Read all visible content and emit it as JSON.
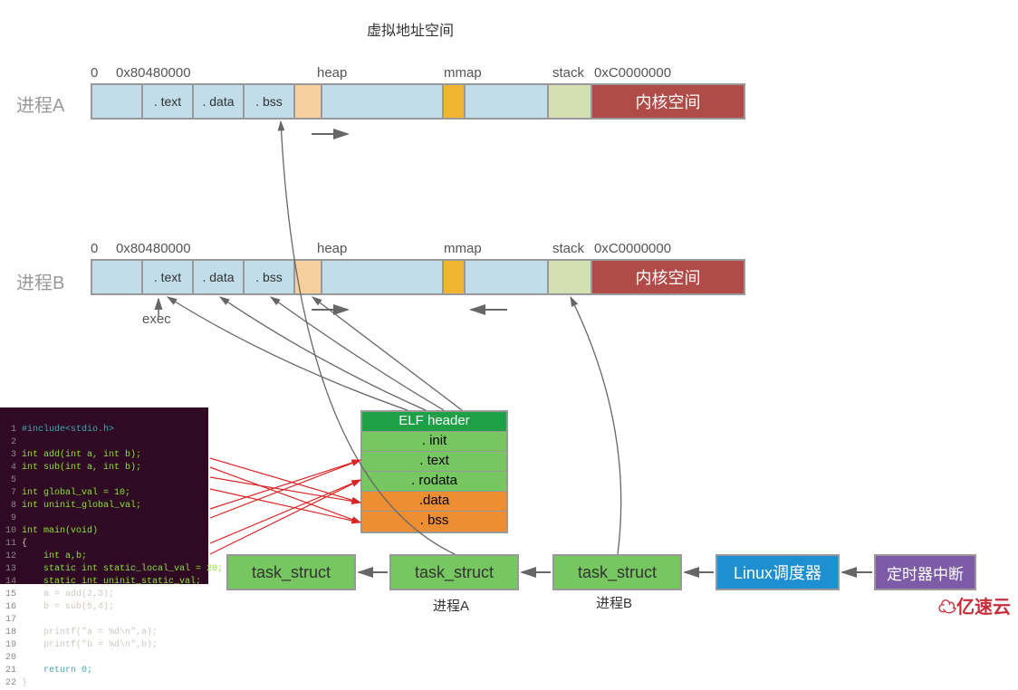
{
  "title": "虚拟地址空间",
  "processA": {
    "name": "进程A",
    "zero": "0",
    "addr1": "0x80480000",
    "heap": "heap",
    "mmap": "mmap",
    "stack": "stack",
    "kaddr": "0xC0000000",
    "text": ". text",
    "data": ". data",
    "bss": ". bss",
    "kernel": "内核空间"
  },
  "processB": {
    "name": "进程B",
    "zero": "0",
    "addr1": "0x80480000",
    "heap": "heap",
    "mmap": "mmap",
    "stack": "stack",
    "kaddr": "0xC0000000",
    "text": ". text",
    "data": ". data",
    "bss": ". bss",
    "kernel": "内核空间",
    "exec": "exec"
  },
  "elf": {
    "header": "ELF header",
    "init": ". init",
    "text": ". text",
    "rodata": ". rodata",
    "data": ".data",
    "bss": ". bss"
  },
  "bottom": {
    "task": "task_struct",
    "procA": "进程A",
    "procB": "进程B",
    "sched": "Linux调度器",
    "timer": "定时器中断"
  },
  "logo": "亿速云",
  "code": {
    "l1": "#include<stdio.h>",
    "l3": "int add(int a, int b);",
    "l4": "int sub(int a, int b);",
    "l7": "int global_val = 10;",
    "l8": "int uninit_global_val;",
    "l10": "int main(void)",
    "l11": "{",
    "l12": "    int a,b;",
    "l13": "    static int static_local_val = 20;",
    "l14": "    static int uninit_static_val;",
    "l15": "    a = add(2,3);",
    "l16": "    b = sub(5,4);",
    "l18": "    printf(\"a = %d\\n\",a);",
    "l19": "    printf(\"b = %d\\n\",b);",
    "l21": "    return 0;",
    "l22": "}"
  }
}
